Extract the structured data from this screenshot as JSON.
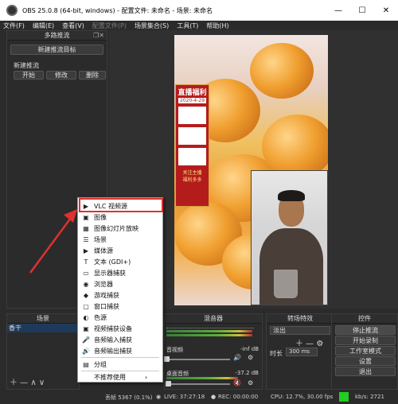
{
  "window": {
    "title": "OBS 25.0.8 (64-bit, windows) - 配置文件: 未命名 - 场景: 未命名",
    "minimize": "—",
    "maximize": "☐",
    "close": "✕"
  },
  "menu": [
    "文件(F)",
    "编辑(E)",
    "查看(V)",
    "配置文件(P)",
    "场景集合(S)",
    "工具(T)",
    "帮助(H)"
  ],
  "multistream": {
    "title": "多路推流",
    "add_target": "新建推流目标",
    "item_name": "新建推流",
    "start": "开始",
    "edit": "修改",
    "delete": "删除"
  },
  "poster": {
    "title": "直播福利",
    "date": "2020-4-29",
    "footer_line1": "关注主播",
    "footer_line2": "福利多多"
  },
  "context_menu": {
    "items": [
      {
        "icon": "▶",
        "icon_name": "play-icon",
        "label": "VLC 视频源"
      },
      {
        "icon": "▣",
        "icon_name": "image-icon",
        "label": "图像"
      },
      {
        "icon": "▦",
        "icon_name": "slideshow-icon",
        "label": "图像幻灯片放映"
      },
      {
        "icon": "☰",
        "icon_name": "scene-icon",
        "label": "场景"
      },
      {
        "icon": "▶",
        "icon_name": "media-icon",
        "label": "媒体源"
      },
      {
        "icon": "T",
        "icon_name": "text-icon",
        "label": "文本 (GDI+)"
      },
      {
        "icon": "▭",
        "icon_name": "monitor-icon",
        "label": "显示器捕获"
      },
      {
        "icon": "◉",
        "icon_name": "browser-icon",
        "label": "浏览器"
      },
      {
        "icon": "◆",
        "icon_name": "game-icon",
        "label": "游戏捕获"
      },
      {
        "icon": "▢",
        "icon_name": "window-icon",
        "label": "窗口捕获"
      },
      {
        "icon": "◐",
        "icon_name": "color-icon",
        "label": "色源"
      },
      {
        "icon": "▣",
        "icon_name": "camera-icon",
        "label": "视频捕获设备"
      },
      {
        "icon": "🎤",
        "icon_name": "microphone-icon",
        "label": "音频输入捕获"
      },
      {
        "icon": "🔊",
        "icon_name": "speaker-icon",
        "label": "音频输出捕获"
      }
    ],
    "group": {
      "icon": "▤",
      "icon_name": "folder-icon",
      "label": "分组"
    },
    "deprecated": "不推荐使用",
    "submenu_arrow": "›"
  },
  "docks": {
    "scenes": {
      "title": "场景",
      "item": "香干"
    },
    "mixer": {
      "title": "混音器",
      "track1_db": "-inf dB",
      "track2_name": "桌面音频",
      "track2_db": "-37.2 dB",
      "track1_prefix": "音视频"
    },
    "transitions": {
      "title": "转场特效",
      "selected": "淡出",
      "duration_label": "时长",
      "duration_value": "300 ms"
    },
    "controls": {
      "title": "控件",
      "stop_stream": "停止推流",
      "start_record": "开始录制",
      "studio_mode": "工作室模式",
      "settings": "设置",
      "exit": "退出"
    }
  },
  "status": {
    "dropped": "丢帧 5367 (0.1%)",
    "live": "LIVE: 37:27:18",
    "rec": "REC: 00:00:00",
    "cpu": "CPU: 12.7%, 30.00 fps",
    "kbps": "kb/s: 2721",
    "indicator_color": "#22cc22"
  },
  "colors": {
    "highlight": "#e03030",
    "arrow": "#e03030",
    "poster": "#b41c1c"
  }
}
